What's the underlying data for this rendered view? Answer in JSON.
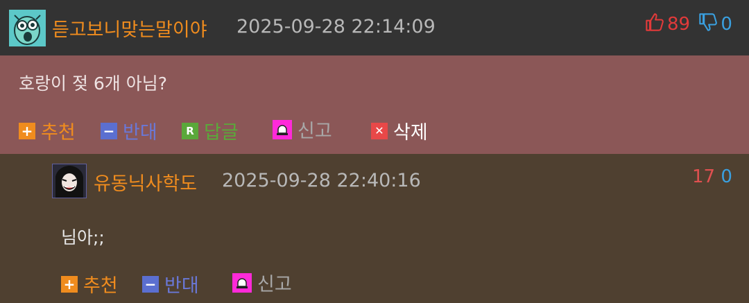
{
  "comment": {
    "nickname": "듣고보니맞는말이야",
    "timestamp": "2025-09-28 22:14:09",
    "upvotes": "89",
    "downvotes": "0",
    "text": "호랑이 젖 6개 아님?",
    "actions": {
      "recommend": "추천",
      "oppose": "반대",
      "reply": "답글",
      "report": "신고",
      "delete": "삭제"
    }
  },
  "reply": {
    "nickname": "유동닉사학도",
    "timestamp": "2025-09-28 22:40:16",
    "upvotes": "17",
    "downvotes": "0",
    "text": "님아;;",
    "actions": {
      "recommend": "추천",
      "oppose": "반대",
      "report": "신고"
    }
  },
  "colors": {
    "header_bg": "#333333",
    "comment_bg": "#8b5757",
    "reply_bg": "#4f4030",
    "nickname": "#f08c1e",
    "upvote": "#e23a3a",
    "downvote": "#3aa0e0"
  },
  "icons": {
    "thumbs_up": "thumbs-up-icon",
    "thumbs_down": "thumbs-down-icon",
    "plus": "plus-icon",
    "minus": "minus-icon",
    "reply": "reply-r-icon",
    "report": "siren-icon",
    "delete": "close-icon"
  }
}
